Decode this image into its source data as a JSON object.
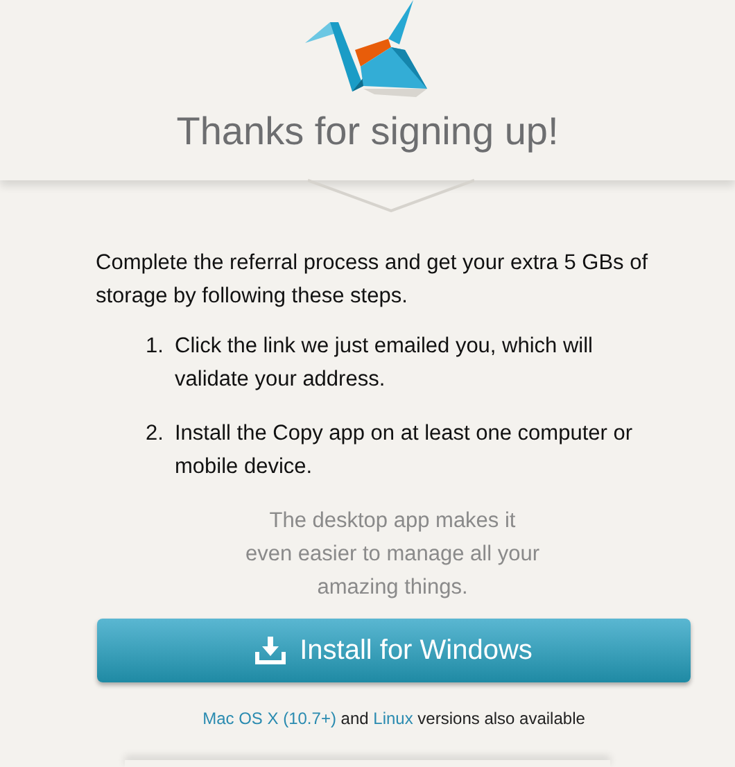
{
  "header": {
    "title": "Thanks for signing up!"
  },
  "intro": "Complete the referral process and get your extra 5 GBs of storage by following these steps.",
  "steps": [
    {
      "number": "1.",
      "text": "Click the link we just emailed you, which will validate your address."
    },
    {
      "number": "2.",
      "text": "Install the Copy app on at least one computer or mobile device."
    }
  ],
  "desktop_note": "The desktop app makes it even easier to manage all your amazing things.",
  "install_button": {
    "label": "Install for Windows"
  },
  "footer": {
    "links": [
      "Mac OS X (10.7+)",
      "Linux"
    ],
    "joiner": "and",
    "tail": "versions also available"
  }
}
